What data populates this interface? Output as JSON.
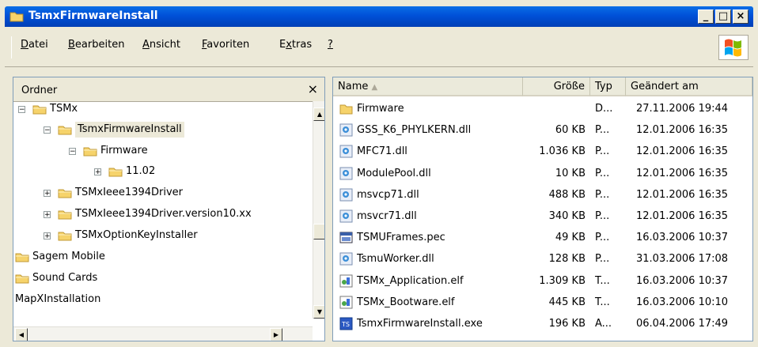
{
  "window": {
    "title": "TsmxFirmwareInstall"
  },
  "titlebar_buttons": [
    {
      "name": "minimize-button",
      "glyph": "_"
    },
    {
      "name": "maximize-button",
      "glyph": "□"
    },
    {
      "name": "close-button",
      "glyph": "×"
    }
  ],
  "menu": [
    {
      "name": "menu-datei",
      "pre": "",
      "u": "D",
      "post": "atei"
    },
    {
      "name": "menu-bearbeiten",
      "pre": "",
      "u": "B",
      "post": "earbeiten"
    },
    {
      "name": "menu-ansicht",
      "pre": "",
      "u": "A",
      "post": "nsicht"
    },
    {
      "name": "menu-favoriten",
      "pre": "",
      "u": "F",
      "post": "avoriten"
    },
    {
      "name": "menu-extras",
      "pre": "E",
      "u": "x",
      "post": "tras"
    },
    {
      "name": "menu-help",
      "pre": "",
      "u": "?",
      "post": ""
    }
  ],
  "folder_pane": {
    "header": "Ordner",
    "close_glyph": "×",
    "tree": [
      {
        "label": "TSMx",
        "expander": "−",
        "name": "tree-item-tsmx"
      },
      {
        "label": "TsmxFirmwareInstall",
        "expander": "−",
        "name": "tree-item-tsmxfirmwareinstall",
        "selected": true
      },
      {
        "label": "Firmware",
        "expander": "−",
        "name": "tree-item-firmware"
      },
      {
        "label": "11.02",
        "expander": "+",
        "name": "tree-item-11-02"
      },
      {
        "label": "TSMxIeee1394Driver",
        "expander": "+",
        "name": "tree-item-tsmxieee1394driver"
      },
      {
        "label": "TSMxIeee1394Driver.version10.xx",
        "expander": "+",
        "name": "tree-item-tsmxieee1394driver-version10"
      },
      {
        "label": "TSMxOptionKeyInstaller",
        "expander": "+",
        "name": "tree-item-tsmxoptionkeyinstaller"
      },
      {
        "label": "Sagem Mobile",
        "expander": "",
        "name": "tree-item-sagem-mobile"
      },
      {
        "label": "Sound Cards",
        "expander": "",
        "name": "tree-item-sound-cards"
      },
      {
        "label": "MapXInstallation",
        "expander": "",
        "name": "tree-item-mapxinstallation"
      }
    ]
  },
  "file_pane": {
    "columns": [
      "Name",
      "Größe",
      "Typ",
      "Geändert am"
    ],
    "files": [
      {
        "name": "Firmware",
        "size": "",
        "type": "D...",
        "modified": "27.11.2006 19:44",
        "icon": "folder"
      },
      {
        "name": "GSS_K6_PHYLKERN.dll",
        "size": "60 KB",
        "type": "P...",
        "modified": "12.01.2006 16:35",
        "icon": "dll"
      },
      {
        "name": "MFC71.dll",
        "size": "1.036 KB",
        "type": "P...",
        "modified": "12.01.2006 16:35",
        "icon": "dll"
      },
      {
        "name": "ModulePool.dll",
        "size": "10 KB",
        "type": "P...",
        "modified": "12.01.2006 16:35",
        "icon": "dll"
      },
      {
        "name": "msvcp71.dll",
        "size": "488 KB",
        "type": "P...",
        "modified": "12.01.2006 16:35",
        "icon": "dll"
      },
      {
        "name": "msvcr71.dll",
        "size": "340 KB",
        "type": "P...",
        "modified": "12.01.2006 16:35",
        "icon": "dll"
      },
      {
        "name": "TSMUFrames.pec",
        "size": "49 KB",
        "type": "P...",
        "modified": "16.03.2006 10:37",
        "icon": "pec"
      },
      {
        "name": "TsmuWorker.dll",
        "size": "128 KB",
        "type": "P...",
        "modified": "31.03.2006 17:08",
        "icon": "dll"
      },
      {
        "name": "TSMx_Application.elf",
        "size": "1.309 KB",
        "type": "T...",
        "modified": "16.03.2006 10:37",
        "icon": "elf"
      },
      {
        "name": "TSMx_Bootware.elf",
        "size": "445 KB",
        "type": "T...",
        "modified": "16.03.2006 10:10",
        "icon": "elf"
      },
      {
        "name": "TsmxFirmwareInstall.exe",
        "size": "196 KB",
        "type": "A...",
        "modified": "06.04.2006 17:49",
        "icon": "exe"
      }
    ]
  },
  "colors": {
    "titlebar": "#0054e3",
    "folder": "#f6d36b",
    "chrome": "#ece9d8"
  }
}
